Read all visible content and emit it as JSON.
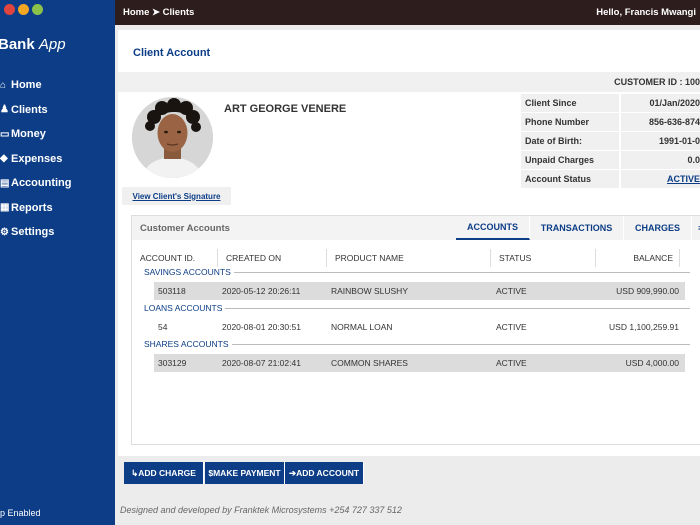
{
  "window": {
    "controls": [
      "close",
      "minimize",
      "maximize"
    ],
    "colors": {
      "close": "#e0443e",
      "minimize": "#f5a623",
      "maximize": "#8bc34a"
    }
  },
  "sidebar": {
    "brand_main": "Bank",
    "brand_sub": "App",
    "items": [
      {
        "label": "Home",
        "icon": "home-icon"
      },
      {
        "label": "Clients",
        "icon": "users-icon"
      },
      {
        "label": "Money",
        "icon": "money-icon"
      },
      {
        "label": "Expenses",
        "icon": "expenses-icon"
      },
      {
        "label": "Accounting",
        "icon": "accounting-icon"
      },
      {
        "label": "Reports",
        "icon": "reports-icon"
      },
      {
        "label": "Settings",
        "icon": "gear-icon"
      }
    ],
    "footer": "ip Enabled"
  },
  "topbar": {
    "breadcrumb_home": "Home",
    "breadcrumb_sep": "➤",
    "breadcrumb_current": "Clients",
    "greeting": "Hello, Francis Mwangi"
  },
  "client": {
    "page_title": "Client Account",
    "customer_id": "CUSTOMER ID : 100",
    "name": "ART GEORGE VENERE",
    "signature_link": "View Client's Signature",
    "info": [
      {
        "label": "Client Since",
        "value": "01/Jan/2020"
      },
      {
        "label": "Phone Number",
        "value": "856-636-874"
      },
      {
        "label": "Date of Birth:",
        "value": "1991-01-0"
      },
      {
        "label": "Unpaid Charges",
        "value": "0.0"
      },
      {
        "label": "Account Status",
        "value": "ACTIVE"
      }
    ]
  },
  "accounts": {
    "title": "Customer Accounts",
    "tabs": [
      "ACCOUNTS",
      "TRANSACTIONS",
      "CHARGES"
    ],
    "tab_more": "≡",
    "columns": [
      "ACCOUNT ID.",
      "CREATED ON",
      "PRODUCT NAME",
      "STATUS",
      "BALANCE"
    ],
    "groups": [
      {
        "label": "SAVINGS ACCOUNTS",
        "rows": [
          {
            "id": "503118",
            "created": "2020-05-12 20:26:11",
            "product": "RAINBOW SLUSHY",
            "status": "ACTIVE",
            "balance": "USD 909,990.00"
          }
        ]
      },
      {
        "label": "LOANS ACCOUNTS",
        "rows": [
          {
            "id": "54",
            "created": "2020-08-01 20:30:51",
            "product": "NORMAL LOAN",
            "status": "ACTIVE",
            "balance": "USD 1,100,259.91"
          }
        ]
      },
      {
        "label": "SHARES ACCOUNTS",
        "rows": [
          {
            "id": "303129",
            "created": "2020-08-07 21:02:41",
            "product": "COMMON SHARES",
            "status": "ACTIVE",
            "balance": "USD 4,000.00"
          }
        ]
      }
    ]
  },
  "actions": {
    "add_charge": {
      "icon": "↳",
      "label": "ADD CHARGE"
    },
    "make_payment": {
      "icon": "$",
      "label": "MAKE PAYMENT"
    },
    "add_account": {
      "icon": "➔",
      "label": "ADD ACCOUNT"
    }
  },
  "footer": "Designed and developed by Franktek Microsystems +254 727 337 512"
}
